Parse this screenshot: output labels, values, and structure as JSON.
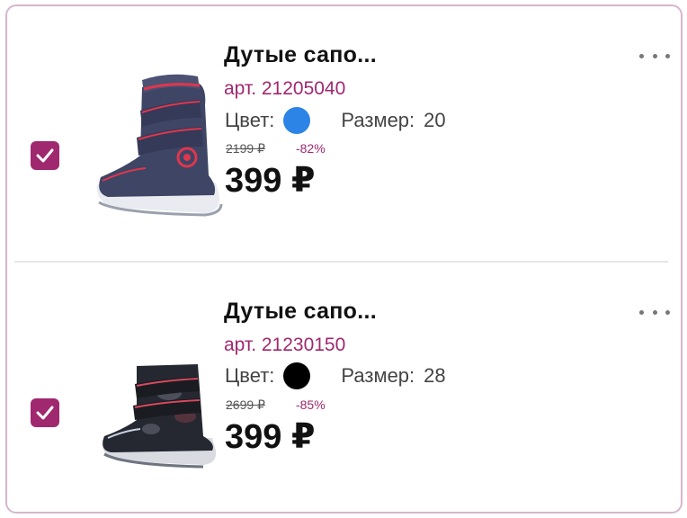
{
  "items": [
    {
      "title": "Дутые сапо...",
      "sku": "арт. 21205040",
      "color_label": "Цвет:",
      "color_value": "#2b84e6",
      "size_label": "Размер:",
      "size_value": "20",
      "old_price": "2199 ₽",
      "discount": "-82%",
      "price": "399 ₽",
      "checked": true,
      "image": "blue-red-winter-boot"
    },
    {
      "title": "Дутые сапо...",
      "sku": "арт. 21230150",
      "color_label": "Цвет:",
      "color_value": "#000000",
      "size_label": "Размер:",
      "size_value": "28",
      "old_price": "2699 ₽",
      "discount": "-85%",
      "price": "399 ₽",
      "checked": true,
      "image": "black-camo-winter-boot"
    }
  ],
  "colors": {
    "accent": "#a0286f",
    "border": "#d7b6cc"
  }
}
